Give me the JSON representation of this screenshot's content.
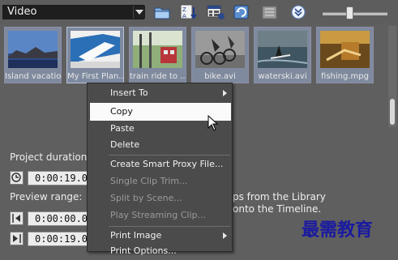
{
  "toolbar": {
    "folder_combo_value": "Video",
    "icons": [
      "folder-open-icon",
      "sort-icon",
      "view-options-icon",
      "refresh-icon",
      "archive-icon",
      "expand-icon"
    ]
  },
  "library": {
    "clips": [
      {
        "caption": "Island vacation"
      },
      {
        "caption": "My First Plan..."
      },
      {
        "caption": "train ride to ..."
      },
      {
        "caption": "bike.avi"
      },
      {
        "caption": "waterski.avi"
      },
      {
        "caption": "fishing.mpg"
      }
    ],
    "hint_line1": "ps from the Library",
    "hint_line2": "onto the Timeline."
  },
  "panel": {
    "project_duration_label": "Project duration:",
    "project_duration_value": "0:00:19.0",
    "preview_range_label": "Preview range:",
    "preview_start_value": "0:00:00.0",
    "preview_end_value": "0:00:19.0"
  },
  "context_menu": {
    "insert_to": "Insert To",
    "copy": "Copy",
    "paste": "Paste",
    "delete": "Delete",
    "create_smart_proxy": "Create Smart Proxy File...",
    "single_clip_trim": "Single Clip Trim...",
    "split_by_scene": "Split by Scene...",
    "play_streaming_clip": "Play Streaming Clip...",
    "print_image": "Print Image",
    "print_options": "Print Options..."
  },
  "watermark": "最需教育"
}
